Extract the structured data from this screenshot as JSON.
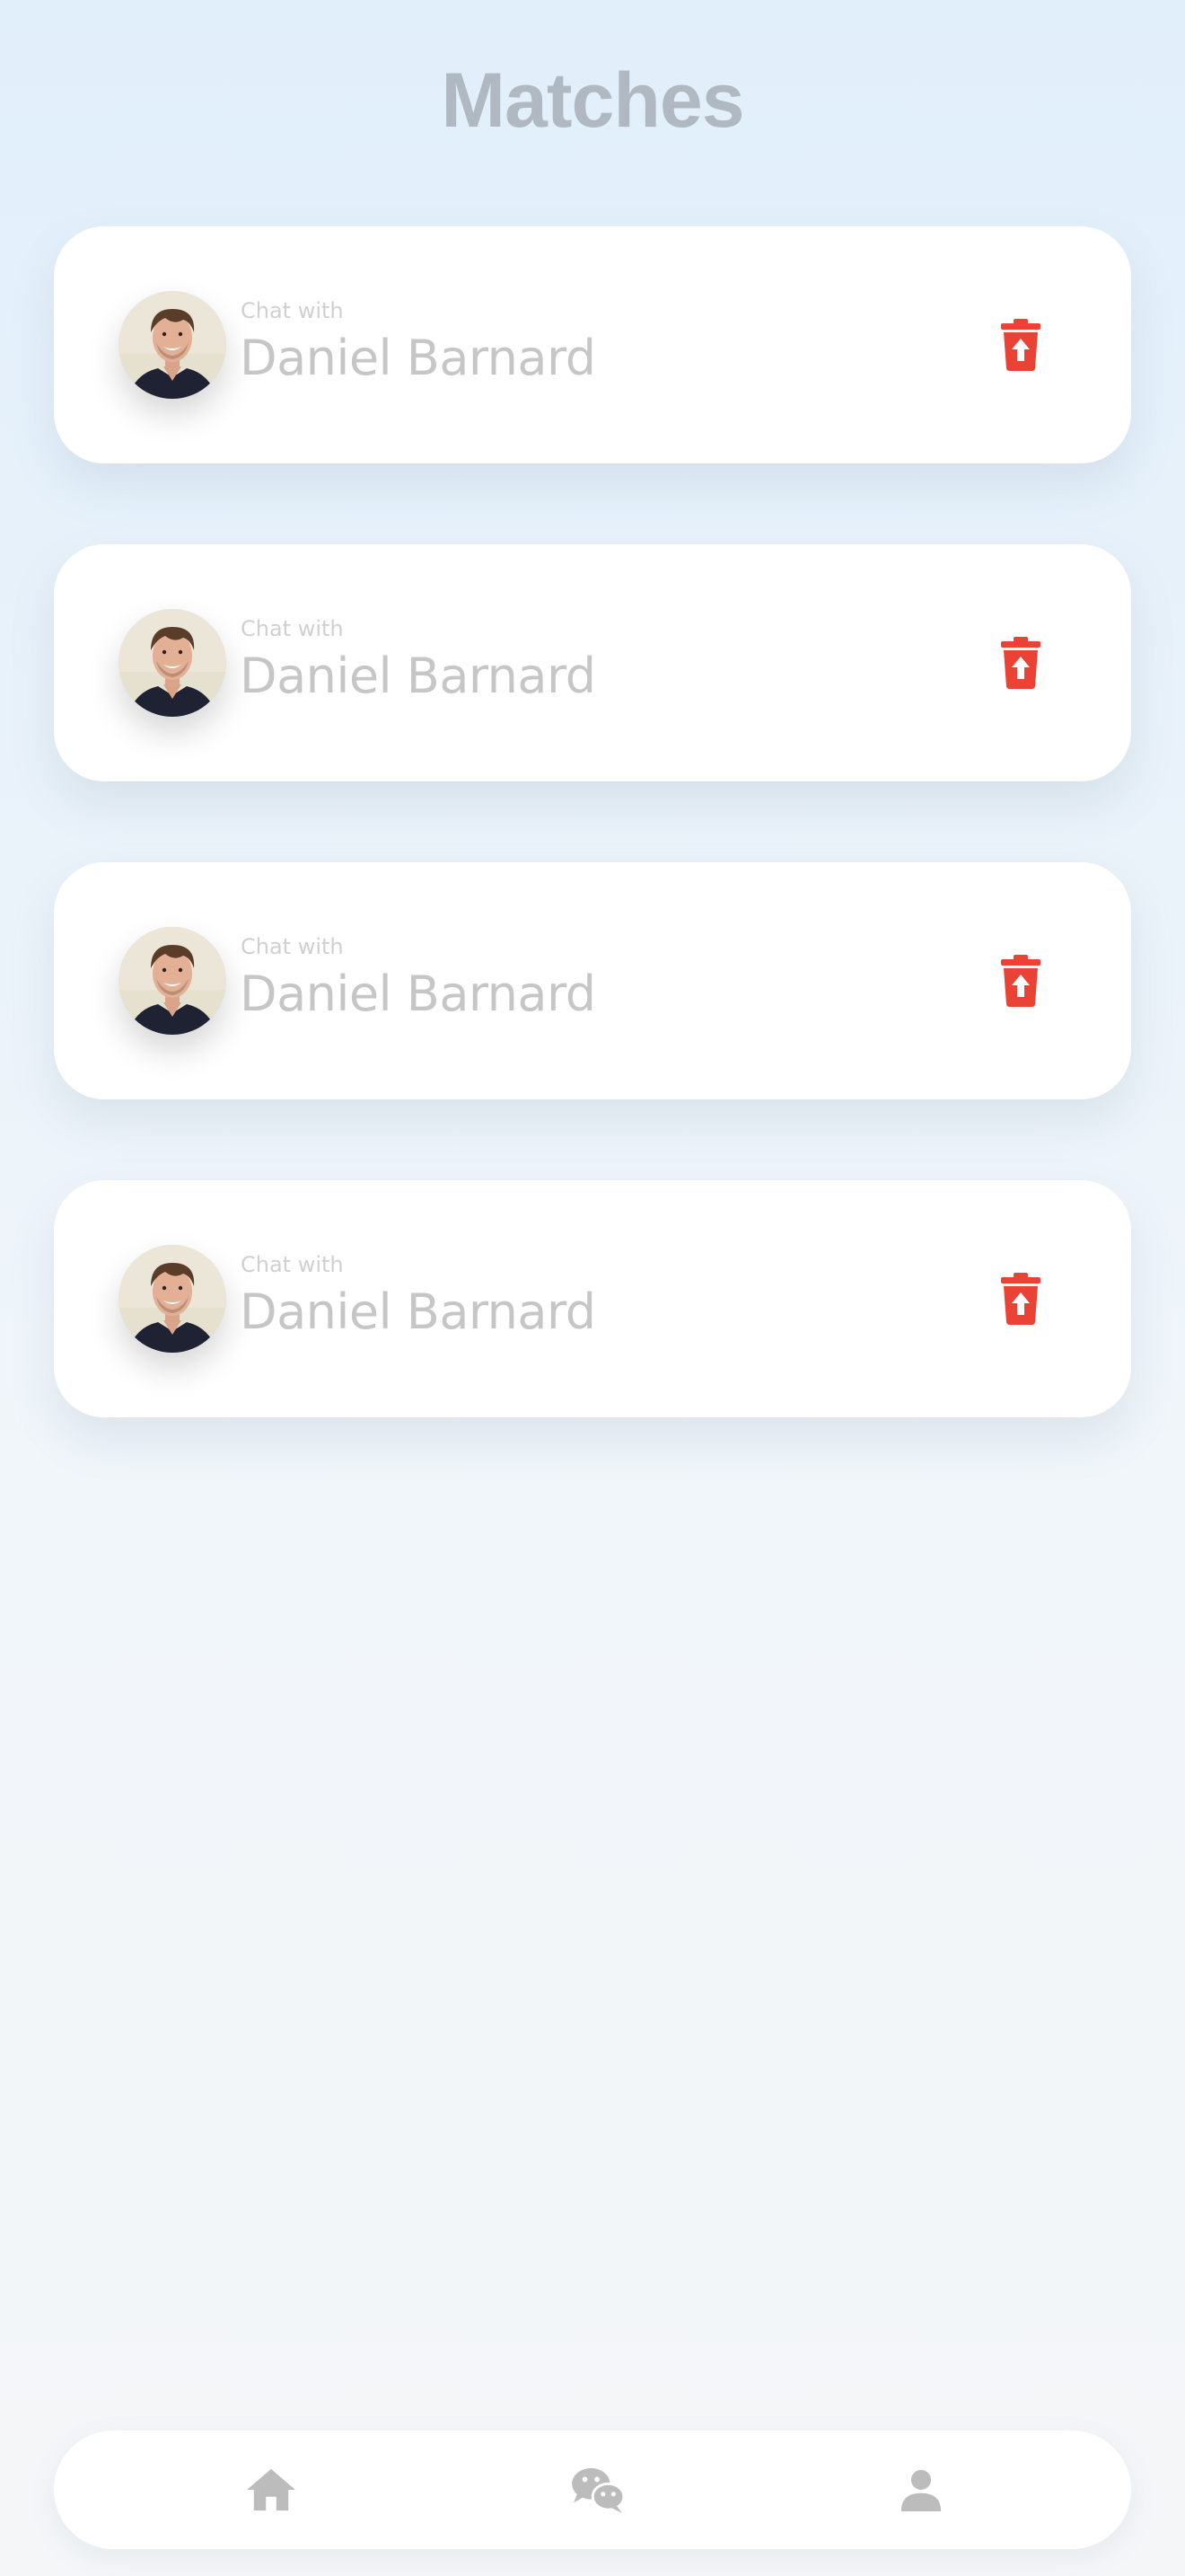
{
  "header": {
    "title": "Matches"
  },
  "matches": [
    {
      "prefix": "Chat with",
      "name": "Daniel Barnard",
      "avatar_icon": "user-photo",
      "action_icon": "trash-restore-icon"
    },
    {
      "prefix": "Chat with",
      "name": "Daniel Barnard",
      "avatar_icon": "user-photo",
      "action_icon": "trash-restore-icon"
    },
    {
      "prefix": "Chat with",
      "name": "Daniel Barnard",
      "avatar_icon": "user-photo",
      "action_icon": "trash-restore-icon"
    },
    {
      "prefix": "Chat with",
      "name": "Daniel Barnard",
      "avatar_icon": "user-photo",
      "action_icon": "trash-restore-icon"
    }
  ],
  "bottom_nav": {
    "items": [
      {
        "icon": "home-icon"
      },
      {
        "icon": "wechat-icon"
      },
      {
        "icon": "user-icon"
      }
    ]
  },
  "colors": {
    "title": "#b0b9c1",
    "name_text": "#c6c6c6",
    "prefix_text": "#d0d0d0",
    "delete_icon": "#ea4335",
    "nav_icon": "#bcbcbc",
    "card_bg": "#ffffff",
    "background_top": "#e1effb",
    "background_bottom": "#f4f6f8"
  }
}
